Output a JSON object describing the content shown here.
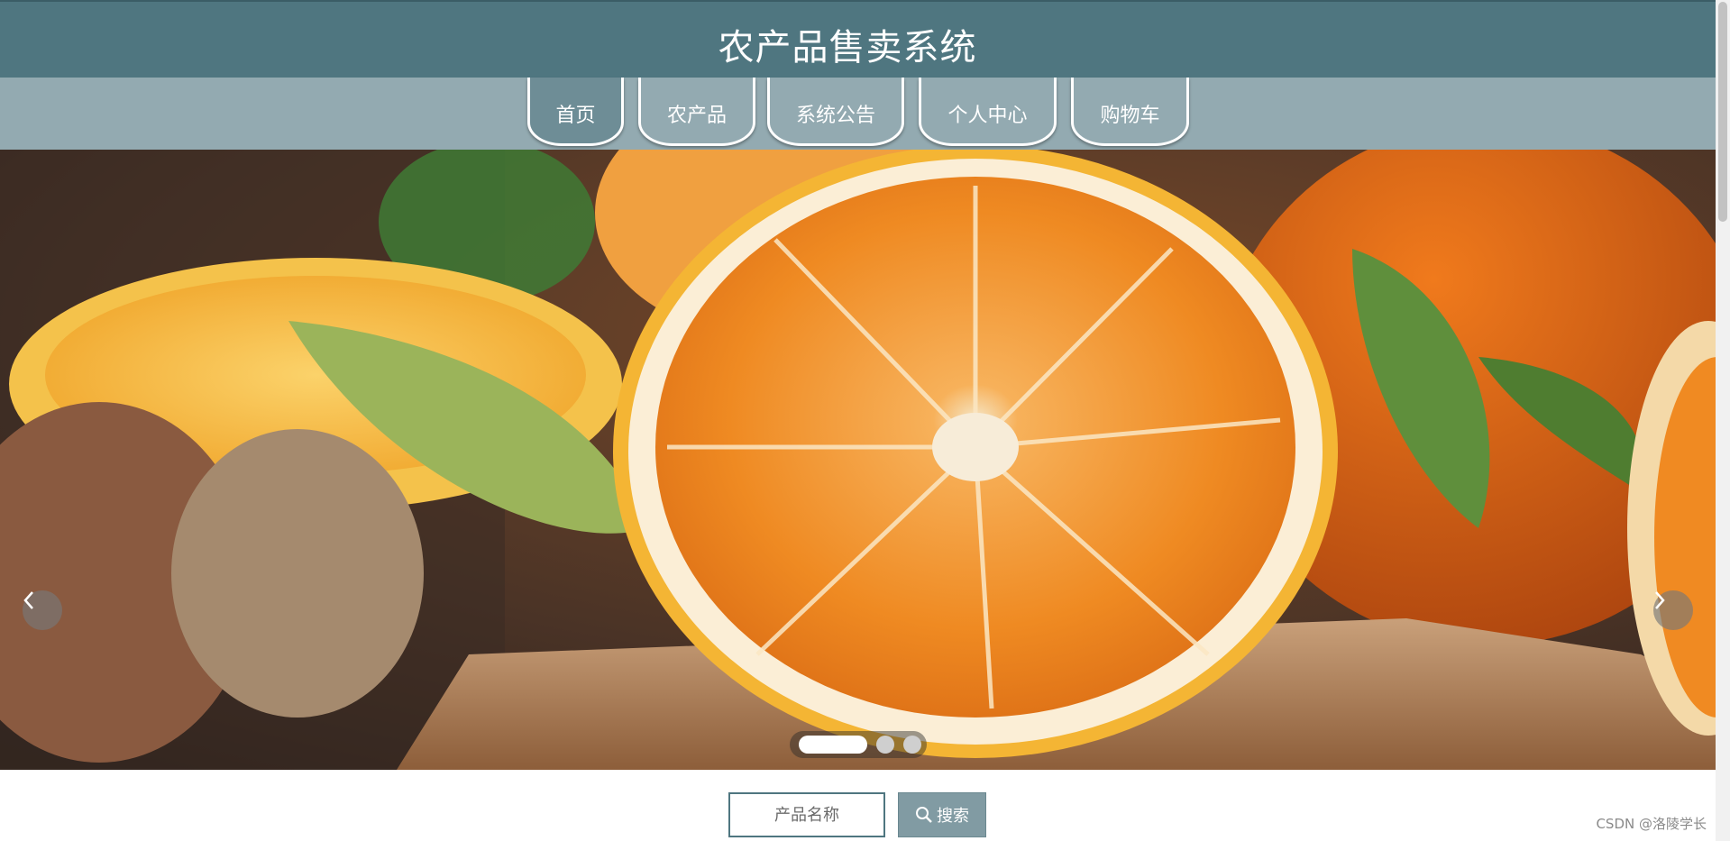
{
  "header": {
    "title": "农产品售卖系统"
  },
  "nav": {
    "items": [
      {
        "label": "首页"
      },
      {
        "label": "农产品"
      },
      {
        "label": "系统公告"
      },
      {
        "label": "个人中心"
      },
      {
        "label": "购物车"
      }
    ]
  },
  "banner": {
    "prev_icon": "chevron-left-icon",
    "next_icon": "chevron-right-icon",
    "slide_count": 3,
    "active_slide": 1
  },
  "search": {
    "placeholder": "产品名称",
    "button_label": "搜索",
    "button_icon": "search-icon"
  },
  "watermark": "CSDN @洛陵学长",
  "colors": {
    "header_bg": "#4f7680",
    "nav_bg": "#93aab1",
    "button_bg": "#819ba3"
  }
}
